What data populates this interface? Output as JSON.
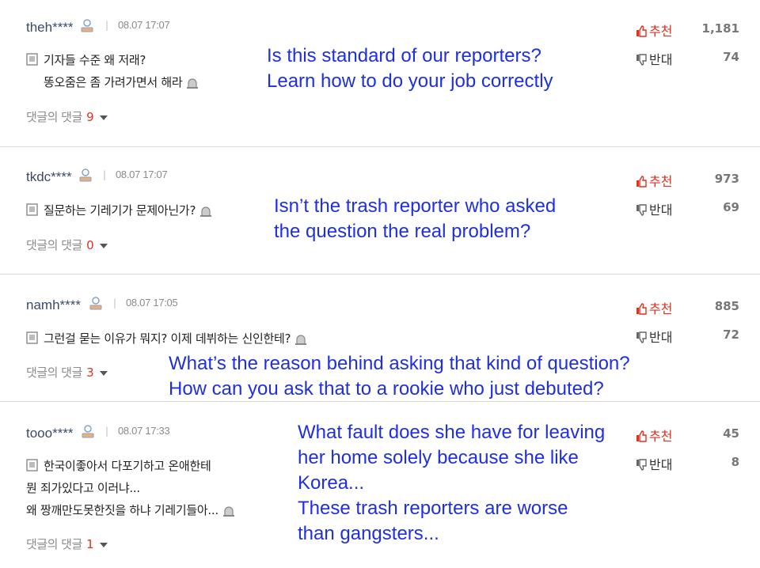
{
  "comments": [
    {
      "username": "theh****",
      "datetime": "08.07 17:07",
      "lines": [
        "기자들 수준 왜 저래?",
        "똥오줌은 좀 가려가면서 해라"
      ],
      "replies_label": "댓글의 댓글",
      "replies_count": "9",
      "upvote_label": "추천",
      "upvote_count": "1,181",
      "downvote_label": "반대",
      "downvote_count": "74",
      "translation": [
        "Is this standard of our reporters?",
        "Learn how to do your job correctly"
      ]
    },
    {
      "username": "tkdc****",
      "datetime": "08.07 17:07",
      "lines": [
        "질문하는 기레기가 문제아닌가?"
      ],
      "replies_label": "댓글의 댓글",
      "replies_count": "0",
      "upvote_label": "추천",
      "upvote_count": "973",
      "downvote_label": "반대",
      "downvote_count": "69",
      "translation": [
        "Isn’t the trash reporter who asked",
        "the question the real problem?"
      ]
    },
    {
      "username": "namh****",
      "datetime": "08.07 17:05",
      "lines": [
        "그런걸 묻는 이유가 뭐지? 이제 데뷔하는 신인한테?"
      ],
      "replies_label": "댓글의 댓글",
      "replies_count": "3",
      "upvote_label": "추천",
      "upvote_count": "885",
      "downvote_label": "반대",
      "downvote_count": "72",
      "translation": [
        "What’s the reason behind asking that kind of question?",
        "How can you ask that to a rookie who just debuted?"
      ]
    },
    {
      "username": "tooo****",
      "datetime": "08.07 17:33",
      "lines": [
        "한국이좋아서 다포기하고 온애한테",
        "뭔 죄가있다고 이러냐...",
        "왜 짱깨만도못한짓을 하냐 기레기들아..."
      ],
      "replies_label": "댓글의 댓글",
      "replies_count": "1",
      "upvote_label": "추천",
      "upvote_count": "45",
      "downvote_label": "반대",
      "downvote_count": "8",
      "translation": [
        "What fault does she have for leaving",
        "her home solely because she like",
        "Korea...",
        "These trash reporters are worse",
        "than gangsters..."
      ]
    }
  ],
  "colors": {
    "upvote": "#e0301e",
    "reply_count": "#e0301e",
    "translation_text": "#1f2fe0",
    "username": "#3a4a6b"
  },
  "icons": [
    "user-icon",
    "document-icon",
    "report-icon",
    "thumbs-up-icon",
    "thumbs-down-icon",
    "caret-down-icon"
  ]
}
